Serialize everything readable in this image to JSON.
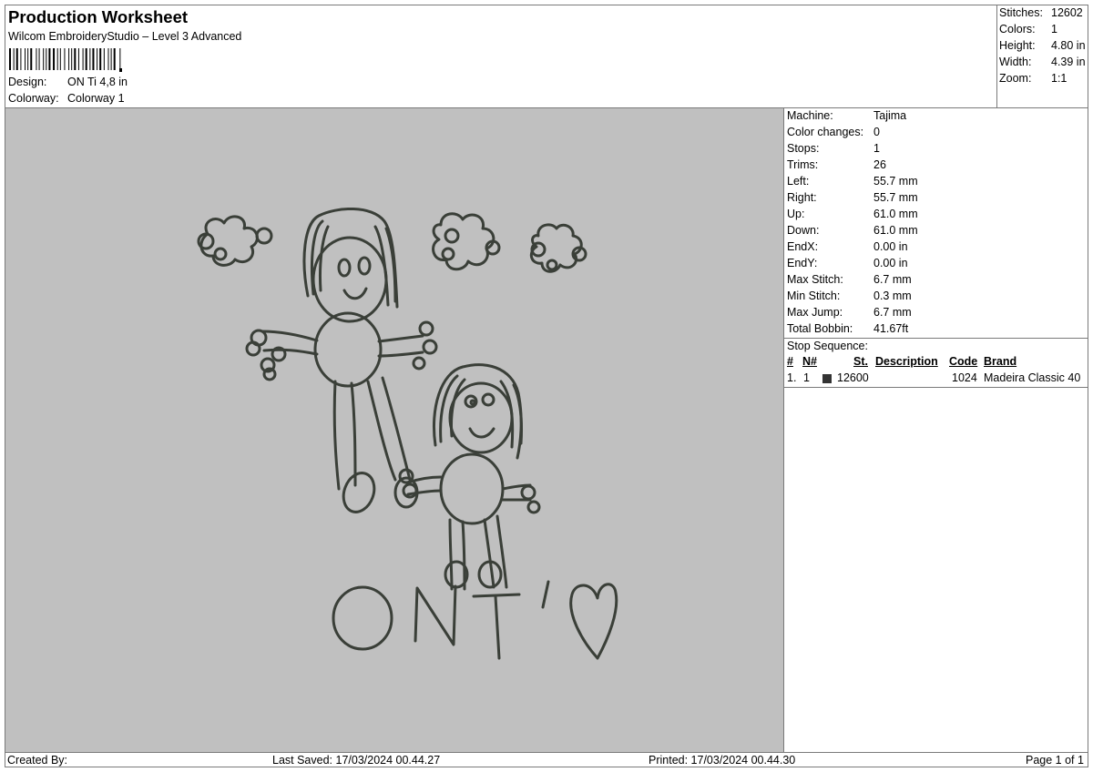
{
  "header": {
    "title": "Production Worksheet",
    "subtitle": "Wilcom EmbroideryStudio – Level 3 Advanced",
    "design_label": "Design:",
    "design_value": "ON Ti 4,8 in",
    "colorway_label": "Colorway:",
    "colorway_value": "Colorway 1"
  },
  "stats": [
    {
      "label": "Stitches:",
      "value": "12602"
    },
    {
      "label": "Colors:",
      "value": "1"
    },
    {
      "label": "Height:",
      "value": "4.80 in"
    },
    {
      "label": "Width:",
      "value": "4.39 in"
    },
    {
      "label": "Zoom:",
      "value": "1:1"
    }
  ],
  "machine_info": [
    {
      "label": "Machine:",
      "value": "Tajima"
    },
    {
      "label": "Color changes:",
      "value": "0"
    },
    {
      "label": "Stops:",
      "value": "1"
    },
    {
      "label": "Trims:",
      "value": "26"
    },
    {
      "label": "Left:",
      "value": "55.7 mm"
    },
    {
      "label": "Right:",
      "value": "55.7 mm"
    },
    {
      "label": "Up:",
      "value": "61.0 mm"
    },
    {
      "label": "Down:",
      "value": "61.0 mm"
    },
    {
      "label": "EndX:",
      "value": "0.00 in"
    },
    {
      "label": "EndY:",
      "value": "0.00 in"
    },
    {
      "label": "Max Stitch:",
      "value": "6.7 mm"
    },
    {
      "label": "Min Stitch:",
      "value": "0.3 mm"
    },
    {
      "label": "Max Jump:",
      "value": "6.7 mm"
    },
    {
      "label": "Total Bobbin:",
      "value": "41.67ft"
    }
  ],
  "stop_sequence": {
    "title": "Stop Sequence:",
    "headers": {
      "num": "#",
      "needle": "N#",
      "stitches": "St.",
      "description": "Description",
      "code": "Code",
      "brand": "Brand"
    },
    "rows": [
      {
        "num": "1.",
        "needle": "1",
        "color": "#333333",
        "stitches": "12600",
        "description": "",
        "code": "1024",
        "brand": "Madeira Classic 40"
      }
    ]
  },
  "design_text": "ON T'",
  "colors": {
    "thread": "#3a3f38",
    "background": "#c0c0c0"
  },
  "footer": {
    "created_by": "Created By:",
    "last_saved": "Last Saved: 17/03/2024 00.44.27",
    "printed": "Printed: 17/03/2024 00.44.30",
    "page": "Page 1 of 1"
  }
}
